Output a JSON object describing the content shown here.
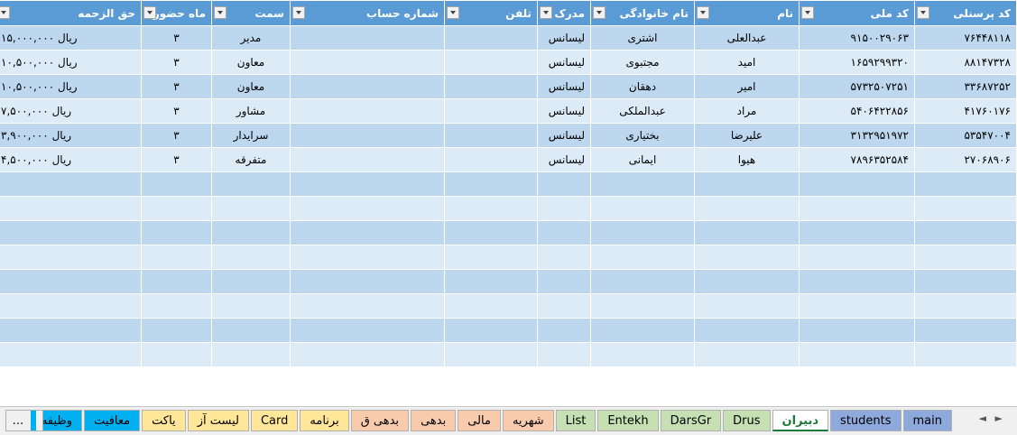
{
  "headers": [
    "کد پرسنلی",
    "کد ملی",
    "نام",
    "نام خانوادگی",
    "مدرک",
    "تلفن",
    "شماره حساب",
    "سمت",
    "ماه حضور",
    "حق الزحمه"
  ],
  "rows": [
    [
      "۷۶۴۴۸۱۱۸",
      "۹۱۵۰۰۲۹۰۶۳",
      "عبدالعلی",
      "اشتری",
      "لیسانس",
      "",
      "",
      "مدیر",
      "۳",
      "ریال  ۱۵,۰۰۰,۰۰۰"
    ],
    [
      "۸۸۱۴۷۳۲۸",
      "۱۶۵۹۲۹۹۳۲۰",
      "امید",
      "مجتبوی",
      "لیسانس",
      "",
      "",
      "معاون",
      "۳",
      "ریال  ۱۰,۵۰۰,۰۰۰"
    ],
    [
      "۳۳۶۸۷۲۵۲",
      "۵۷۳۲۵۰۷۲۵۱",
      "امیر",
      "دهقان",
      "لیسانس",
      "",
      "",
      "معاون",
      "۳",
      "ریال  ۱۰,۵۰۰,۰۰۰"
    ],
    [
      "۴۱۷۶۰۱۷۶",
      "۵۴۰۶۴۲۲۸۵۶",
      "مراد",
      "عبدالملکی",
      "لیسانس",
      "",
      "",
      "مشاور",
      "۳",
      "ریال  ۷,۵۰۰,۰۰۰"
    ],
    [
      "۵۳۵۴۷۰۰۴",
      "۳۱۳۲۹۵۱۹۷۲",
      "علیرضا",
      "بختیاری",
      "لیسانس",
      "",
      "",
      "سرایدار",
      "۳",
      "ریال  ۳,۹۰۰,۰۰۰"
    ],
    [
      "۲۷۰۶۸۹۰۶",
      "۷۸۹۶۳۵۲۵۸۴",
      "هیوا",
      "ایمانی",
      "لیسانس",
      "",
      "",
      "متفرقه",
      "۳",
      "ریال  ۴,۵۰۰,۰۰۰"
    ]
  ],
  "empty_rows": 8,
  "tabs": [
    {
      "label": "main",
      "color": "#8ea9db"
    },
    {
      "label": "students",
      "color": "#8ea9db"
    },
    {
      "label": "دبیران",
      "color": "#ffffff",
      "active": true
    },
    {
      "label": "Drus",
      "color": "#c6e0b4"
    },
    {
      "label": "DarsGr",
      "color": "#c6e0b4"
    },
    {
      "label": "Entekh",
      "color": "#c6e0b4"
    },
    {
      "label": "List",
      "color": "#c6e0b4"
    },
    {
      "label": "شهریه",
      "color": "#f8cbad"
    },
    {
      "label": "مالی",
      "color": "#f8cbad"
    },
    {
      "label": "بدهی",
      "color": "#f8cbad"
    },
    {
      "label": "بدهی ق",
      "color": "#f8cbad"
    },
    {
      "label": "برنامه",
      "color": "#ffe699"
    },
    {
      "label": "Card",
      "color": "#ffe699"
    },
    {
      "label": "لیست آز",
      "color": "#ffe699"
    },
    {
      "label": "یاکت",
      "color": "#ffe699"
    },
    {
      "label": "معافیت",
      "color": "#00b0f0"
    },
    {
      "label": "وظیفه",
      "color": "#00b0f0"
    }
  ],
  "more_label": "...",
  "nav": {
    "prev": "◄",
    "next": "►"
  }
}
